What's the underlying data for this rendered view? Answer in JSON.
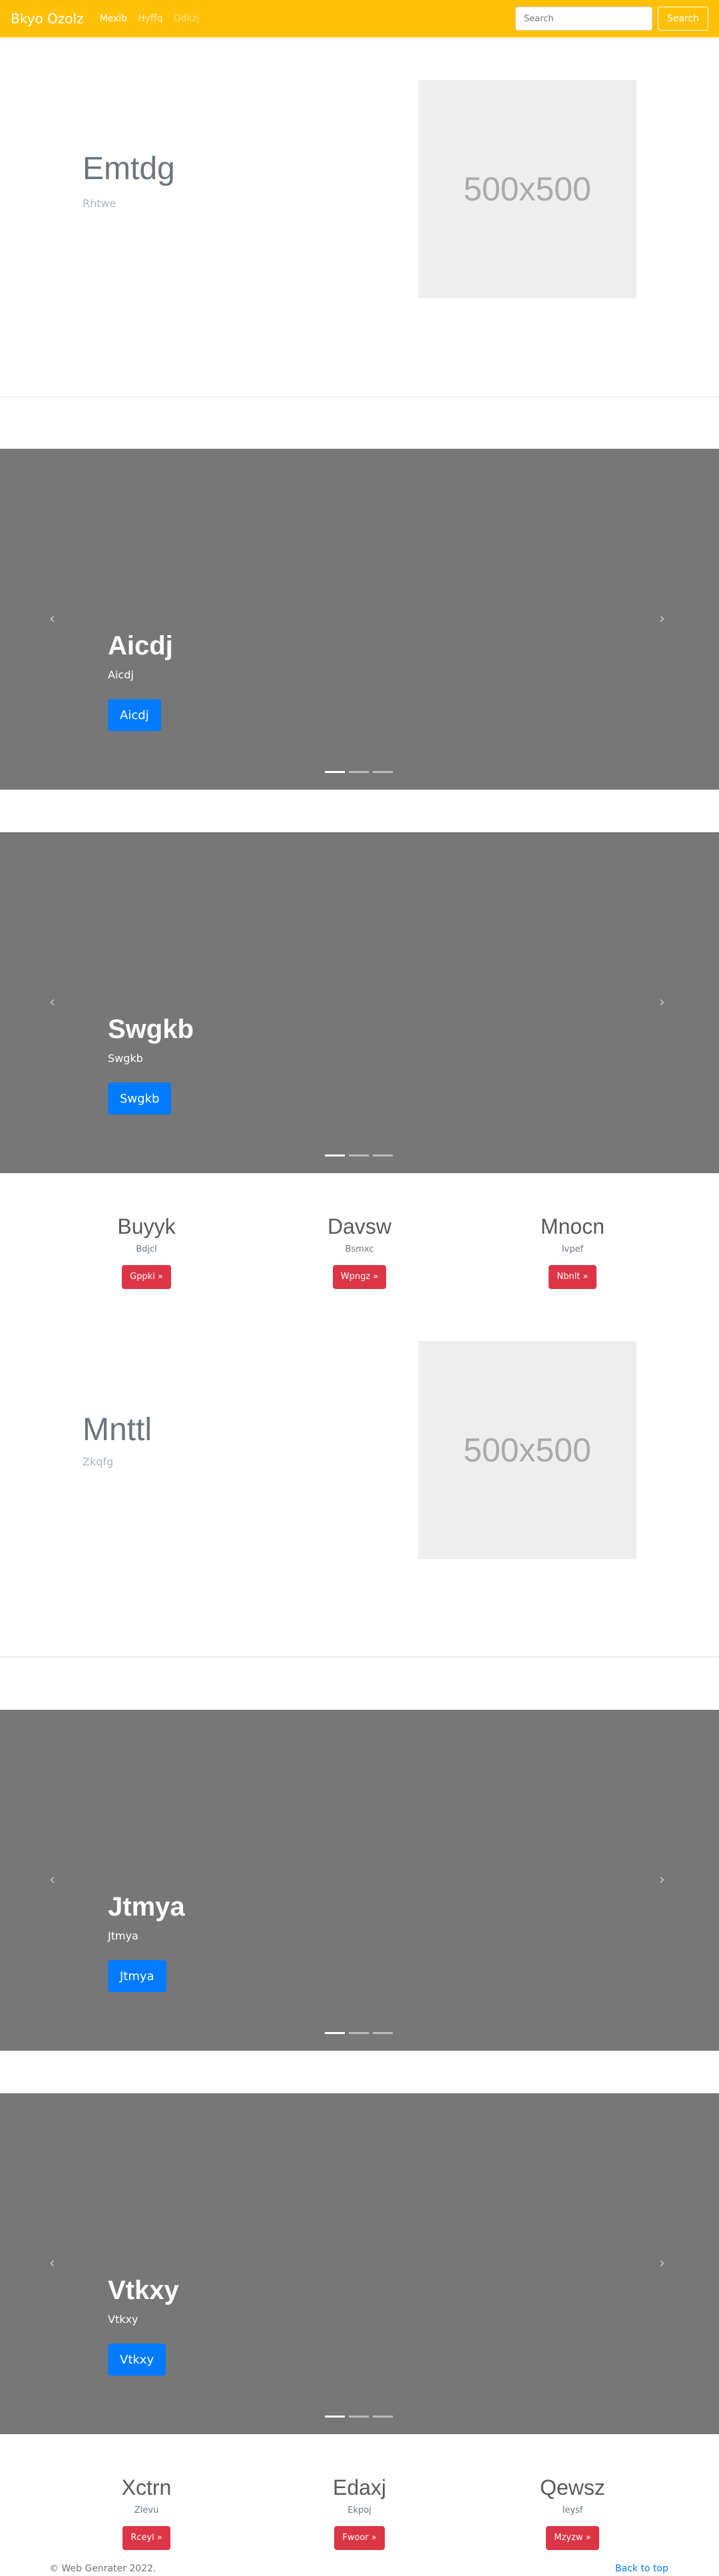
{
  "navbar": {
    "brand": "Bkyo Ozolz",
    "links": [
      {
        "label": "Mexib",
        "state": "active"
      },
      {
        "label": "Hyffq",
        "state": "normal"
      },
      {
        "label": "Qdkzj",
        "state": "disabled"
      }
    ],
    "search_placeholder": "Search",
    "search_button": "Search"
  },
  "sections": {
    "hero1": {
      "title": "Emtdg",
      "subtitle": "Rhtwe",
      "image_text": "500x500"
    },
    "carousel1": {
      "title": "Aicdj",
      "subtitle": "Aicdj",
      "button": "Aicdj"
    },
    "carousel2": {
      "title": "Swgkb",
      "subtitle": "Swgkb",
      "button": "Swgkb"
    },
    "features1": [
      {
        "title": "Buyyk",
        "subtitle": "Bdjcl",
        "button": "Gppki »"
      },
      {
        "title": "Davsw",
        "subtitle": "Bsmxc",
        "button": "Wpngz »"
      },
      {
        "title": "Mnocn",
        "subtitle": "Ivpef",
        "button": "Nbnlt »"
      }
    ],
    "hero2": {
      "title": "Mnttl",
      "subtitle": "Zkqfg",
      "image_text": "500x500"
    },
    "carousel3": {
      "title": "Jtmya",
      "subtitle": "Jtmya",
      "button": "Jtmya"
    },
    "carousel4": {
      "title": "Vtkxy",
      "subtitle": "Vtkxy",
      "button": "Vtkxy"
    },
    "features2": [
      {
        "title": "Xctrn",
        "subtitle": "Zlevu",
        "button": "Rceyl »"
      },
      {
        "title": "Edaxj",
        "subtitle": "Ekpoj",
        "button": "Fwoor »"
      },
      {
        "title": "Qewsz",
        "subtitle": "Ieysf",
        "button": "Mzyzw »"
      }
    ]
  },
  "footer": {
    "copyright": "© Web Genrater 2022.",
    "back_to_top": "Back to top"
  },
  "colors": {
    "navbar": "#ffc107",
    "carousel_bg": "#777777",
    "primary": "#007bff",
    "danger": "#dc3545"
  },
  "icons": {
    "carousel_prev": "chevron-left-icon",
    "carousel_next": "chevron-right-icon"
  }
}
